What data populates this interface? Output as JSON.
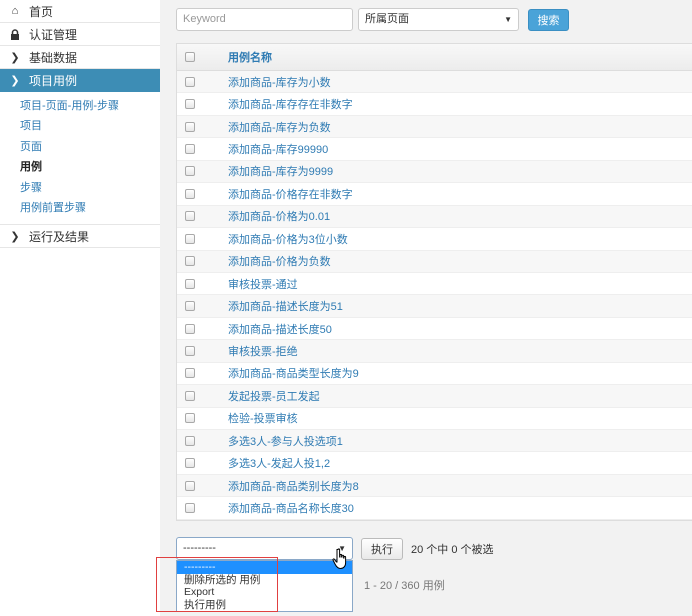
{
  "sidebar": {
    "items": [
      {
        "label": "首页",
        "icon": "home-icon"
      },
      {
        "label": "认证管理",
        "icon": "lock-icon"
      },
      {
        "label": "基础数据",
        "icon": "chevron-right-icon"
      },
      {
        "label": "项目用例",
        "icon": "chevron-right-icon"
      }
    ],
    "sub_items": [
      "项目-页面-用例-步骤",
      "项目",
      "页面",
      "用例",
      "步骤",
      "用例前置步骤"
    ],
    "current_sub": "用例",
    "last_item": {
      "label": "运行及结果",
      "icon": "chevron-right-icon"
    },
    "accent_color": "#3d8db5"
  },
  "toolbar": {
    "keyword_placeholder": "Keyword",
    "page_select_value": "所属页面",
    "search_label": "搜索"
  },
  "table": {
    "header": "用例名称",
    "rows": [
      "添加商品-库存为小数",
      "添加商品-库存存在非数字",
      "添加商品-库存为负数",
      "添加商品-库存99990",
      "添加商品-库存为9999",
      "添加商品-价格存在非数字",
      "添加商品-价格为0.01",
      "添加商品-价格为3位小数",
      "添加商品-价格为负数",
      "审核投票-通过",
      "添加商品-描述长度为51",
      "添加商品-描述长度50",
      "审核投票-拒绝",
      "添加商品-商品类型长度为9",
      "发起投票-员工发起",
      "检验-投票审核",
      "多选3人-参与人投选项1",
      "多选3人-发起人投1,2",
      "添加商品-商品类别长度为8",
      "添加商品-商品名称长度30"
    ]
  },
  "actions": {
    "select_value": "---------",
    "run_label": "执行",
    "selection_count": "20 个中 0 个被选",
    "options": [
      "---------",
      "删除所选的 用例",
      "Export",
      "执行用例"
    ]
  },
  "paging": "1 - 20  /  360 用例"
}
